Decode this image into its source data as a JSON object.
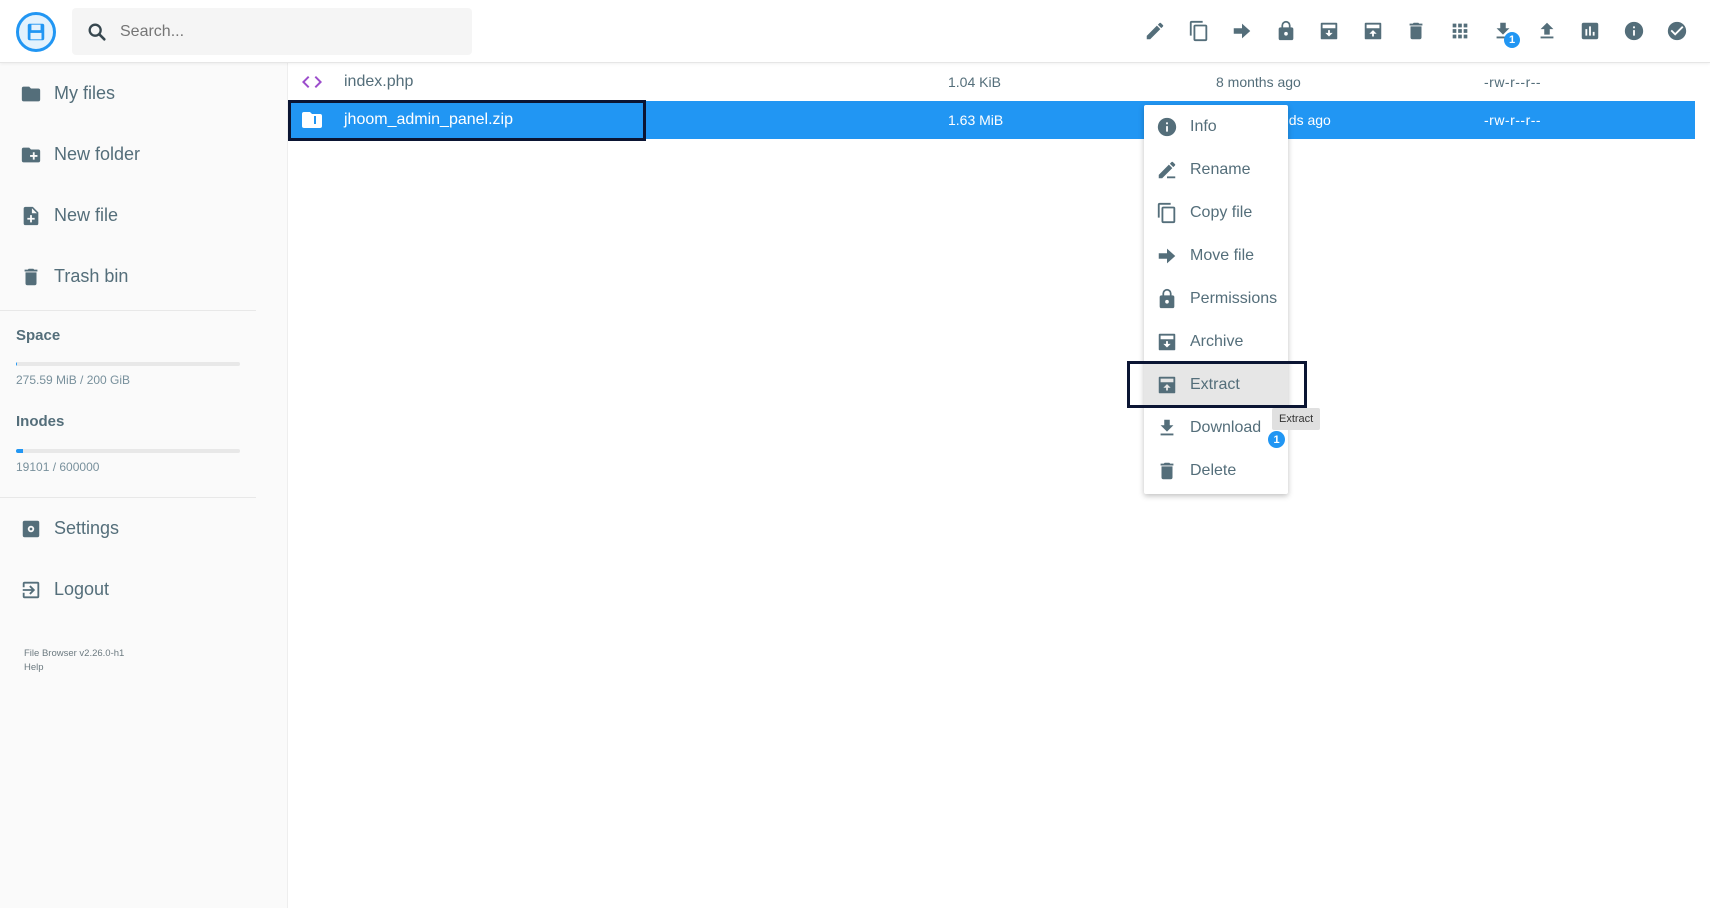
{
  "header": {
    "search_placeholder": "Search...",
    "download_badge": "1",
    "toolbar": [
      {
        "icon": "pencil-icon"
      },
      {
        "icon": "copy-icon"
      },
      {
        "icon": "move-arrow-icon"
      },
      {
        "icon": "lock-icon"
      },
      {
        "icon": "archive-icon"
      },
      {
        "icon": "unarchive-icon"
      },
      {
        "icon": "trash-icon"
      },
      {
        "icon": "grid-view-icon"
      },
      {
        "icon": "download-icon"
      },
      {
        "icon": "upload-icon"
      },
      {
        "icon": "chart-icon"
      },
      {
        "icon": "info-icon"
      },
      {
        "icon": "check-circle-icon"
      }
    ]
  },
  "sidebar": {
    "items": [
      {
        "label": "My files",
        "icon": "folder-icon"
      },
      {
        "label": "New folder",
        "icon": "new-folder-icon"
      },
      {
        "label": "New file",
        "icon": "new-file-icon"
      },
      {
        "label": "Trash bin",
        "icon": "trash-icon"
      }
    ],
    "space": {
      "title": "Space",
      "text": "275.59 MiB / 200 GiB",
      "fraction": 0.0013
    },
    "inodes": {
      "title": "Inodes",
      "text": "19101 / 600000",
      "fraction": 0.032
    },
    "settings_label": "Settings",
    "logout_label": "Logout",
    "version": "File Browser v2.26.0-h1",
    "help": "Help"
  },
  "files": [
    {
      "name": "index.php",
      "size": "1.04 KiB",
      "modified": "8 months ago",
      "permissions": "-rw-r--r--",
      "icon": "code-icon",
      "selected": false
    },
    {
      "name": "jhoom_admin_panel.zip",
      "size": "1.63 MiB",
      "modified": "nds ago",
      "permissions": "-rw-r--r--",
      "icon": "zip-file-icon",
      "selected": true
    }
  ],
  "context_menu": {
    "items": [
      {
        "label": "Info",
        "icon": "info-icon"
      },
      {
        "label": "Rename",
        "icon": "rename-icon"
      },
      {
        "label": "Copy file",
        "icon": "copy-icon"
      },
      {
        "label": "Move file",
        "icon": "move-arrow-icon"
      },
      {
        "label": "Permissions",
        "icon": "lock-icon"
      },
      {
        "label": "Archive",
        "icon": "archive-icon"
      },
      {
        "label": "Extract",
        "icon": "unarchive-icon"
      },
      {
        "label": "Download",
        "icon": "download-icon"
      },
      {
        "label": "Delete",
        "icon": "trash-icon"
      }
    ],
    "download_badge": "1",
    "tooltip": "Extract"
  },
  "colors": {
    "accent": "#2196f3",
    "text": "#546e7a",
    "highlight_border": "#0b1533"
  }
}
